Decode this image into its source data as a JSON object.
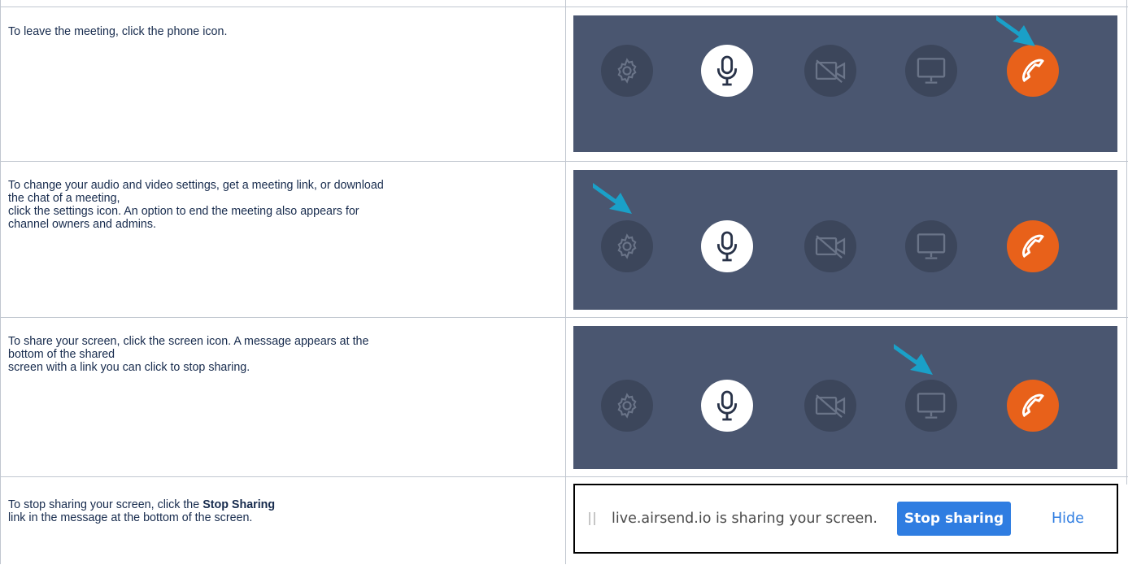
{
  "rows": [
    {
      "text": "To leave the meeting, click the phone icon."
    },
    {
      "text": "To change your audio and video settings, get a meeting link, or download\nthe chat of a meeting,\nclick the settings icon. An option to end the meeting also appears for\nchannel owners and admins."
    },
    {
      "text": "To share your screen, click the screen icon. A message appears at the\nbottom of the shared\nscreen with a link you can click to stop sharing."
    },
    {
      "text_before": "To stop sharing your screen, click the ",
      "text_bold": "Stop Sharing",
      "text_after": "\nlink in the message at the bottom of the screen."
    }
  ],
  "toolbar": {
    "icons": [
      "gear-icon",
      "microphone-icon",
      "video-off-icon",
      "monitor-icon",
      "phone-icon"
    ],
    "colors": {
      "panel": "#4a5670",
      "dark_button": "#3c465b",
      "end_call": "#e8611a",
      "arrow": "#1aa0c8"
    }
  },
  "share_bar": {
    "message": "live.airsend.io is sharing your screen.",
    "stop_label": "Stop sharing",
    "hide_label": "Hide",
    "button_color": "#2f7de1"
  }
}
